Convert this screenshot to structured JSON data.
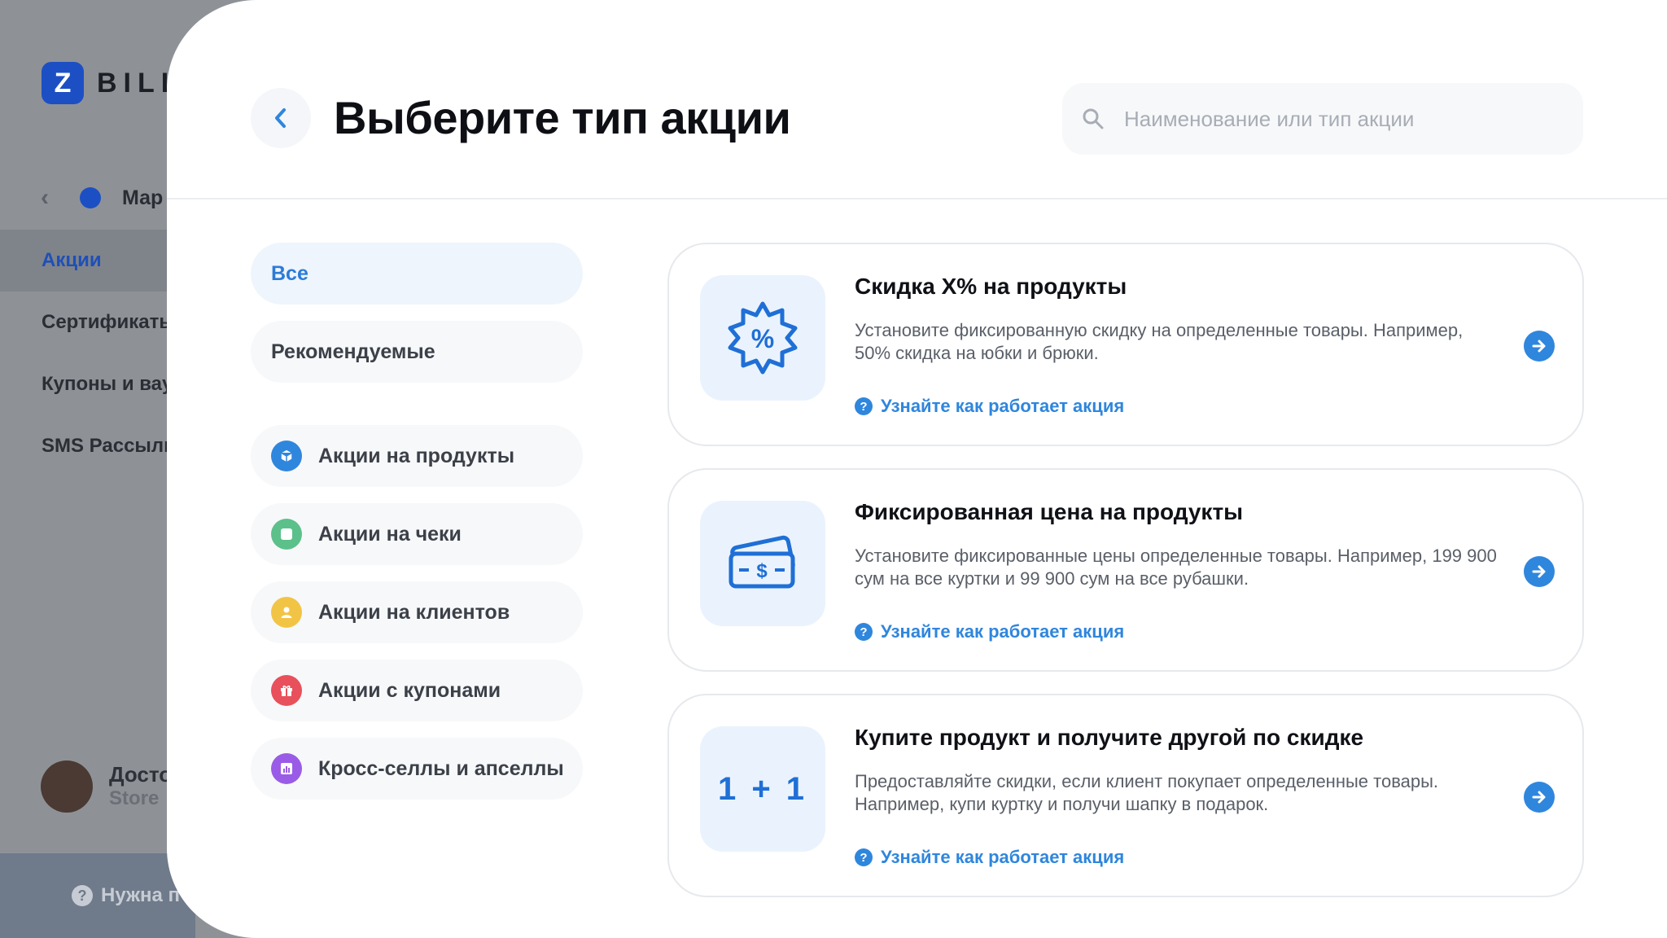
{
  "background_app": {
    "logo_mark": "Z",
    "logo_text": "BILL",
    "breadcrumb_text": "Мар",
    "menu": [
      "Акции",
      "Сертификать",
      "Купоны и вау",
      "SMS Рассылк"
    ],
    "user_name": "Досто",
    "user_role": "Store",
    "help_text": "Нужна п"
  },
  "header": {
    "title": "Выберите тип акции",
    "search_placeholder": "Наименование или тип акции"
  },
  "filters": {
    "all": "Все",
    "recommended": "Рекомендуемые",
    "categories": [
      {
        "label": "Акции на продукты",
        "color": "#2f86dd",
        "icon": "box-icon"
      },
      {
        "label": "Акции на чеки",
        "color": "#5cc08a",
        "icon": "receipt-icon"
      },
      {
        "label": "Акции на клиентов",
        "color": "#f2c445",
        "icon": "user-icon"
      },
      {
        "label": "Акции с купонами",
        "color": "#e8505b",
        "icon": "gift-icon"
      },
      {
        "label": "Кросс-селлы и апселлы",
        "color": "#9a5ce6",
        "icon": "chart-icon"
      }
    ]
  },
  "promos": [
    {
      "title": "Скидка X% на продукты",
      "description": "Установите фиксированную скидку на определенные товары. Например, 50% скидка на юбки и брюки.",
      "link": "Узнайте как работает акция",
      "icon": "percent-badge-icon"
    },
    {
      "title": "Фиксированная цена на продукты",
      "description": "Установите фиксированные цены определенные товары. Например, 199 900 сум на все куртки и 99 900 сум на все рубашки.",
      "link": "Узнайте как работает акция",
      "icon": "cash-icon"
    },
    {
      "title": "Купите продукт и получите другой по скидке",
      "description": "Предоставляйте скидки, если клиент покупает определенные товары. Например, купи куртку и получи шапку в подарок.",
      "link": "Узнайте как работает акция",
      "icon_text": "1 + 1"
    }
  ],
  "colors": {
    "accent": "#2f86dd",
    "title": "#0d0f14",
    "muted": "#5a5f68"
  }
}
